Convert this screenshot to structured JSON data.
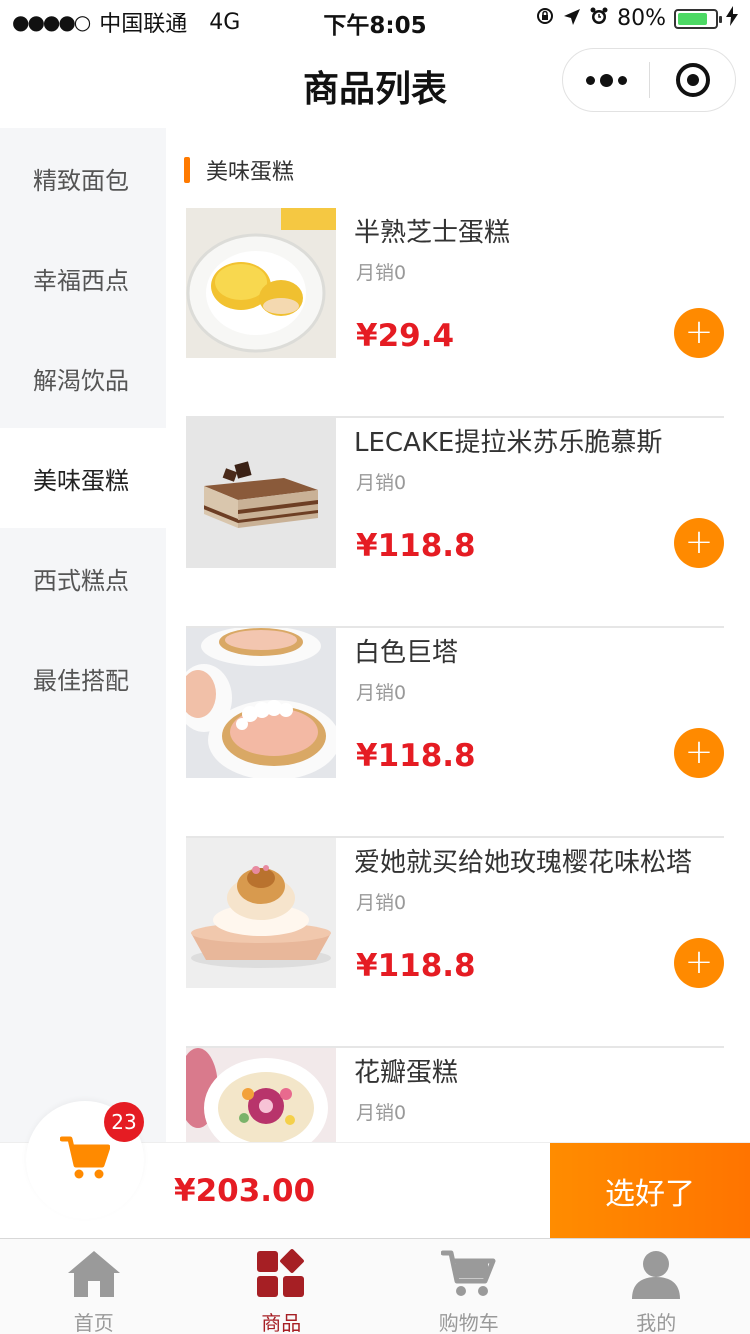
{
  "status_bar": {
    "signal": "●●●●○",
    "carrier": "中国联通",
    "network": "4G",
    "time": "下午8:05",
    "battery": "80%",
    "battery_level": 0.8,
    "battery_color": "#4cd964"
  },
  "nav": {
    "title": "商品列表"
  },
  "sidebar": {
    "items": [
      {
        "label": "精致面包"
      },
      {
        "label": "幸福西点"
      },
      {
        "label": "解渴饮品"
      },
      {
        "label": "美味蛋糕"
      },
      {
        "label": "西式糕点"
      },
      {
        "label": "最佳搭配"
      }
    ],
    "active_index": 3
  },
  "section": {
    "title": "美味蛋糕"
  },
  "products": [
    {
      "name": "半熟芝士蛋糕",
      "sales": "月销0",
      "price": "¥29.4"
    },
    {
      "name": "LECAKE提拉米苏乐脆慕斯",
      "sales": "月销0",
      "price": "¥118.8"
    },
    {
      "name": "白色巨塔",
      "sales": "月销0",
      "price": "¥118.8"
    },
    {
      "name": "爱她就买给她玫瑰樱花味松塔",
      "sales": "月销0",
      "price": "¥118.8"
    },
    {
      "name": "花瓣蛋糕",
      "sales": "月销0",
      "price": ""
    }
  ],
  "add_label": "+",
  "cart": {
    "count": "23",
    "total": "¥203.00",
    "checkout_label": "选好了"
  },
  "tabbar": {
    "items": [
      {
        "label": "首页",
        "icon": "home-icon"
      },
      {
        "label": "商品",
        "icon": "goods-icon"
      },
      {
        "label": "购物车",
        "icon": "cart-icon"
      },
      {
        "label": "我的",
        "icon": "user-icon"
      }
    ],
    "active_index": 1
  },
  "colors": {
    "accent": "#ff8a00",
    "price": "#e51c23",
    "tab_active": "#a61f24"
  }
}
